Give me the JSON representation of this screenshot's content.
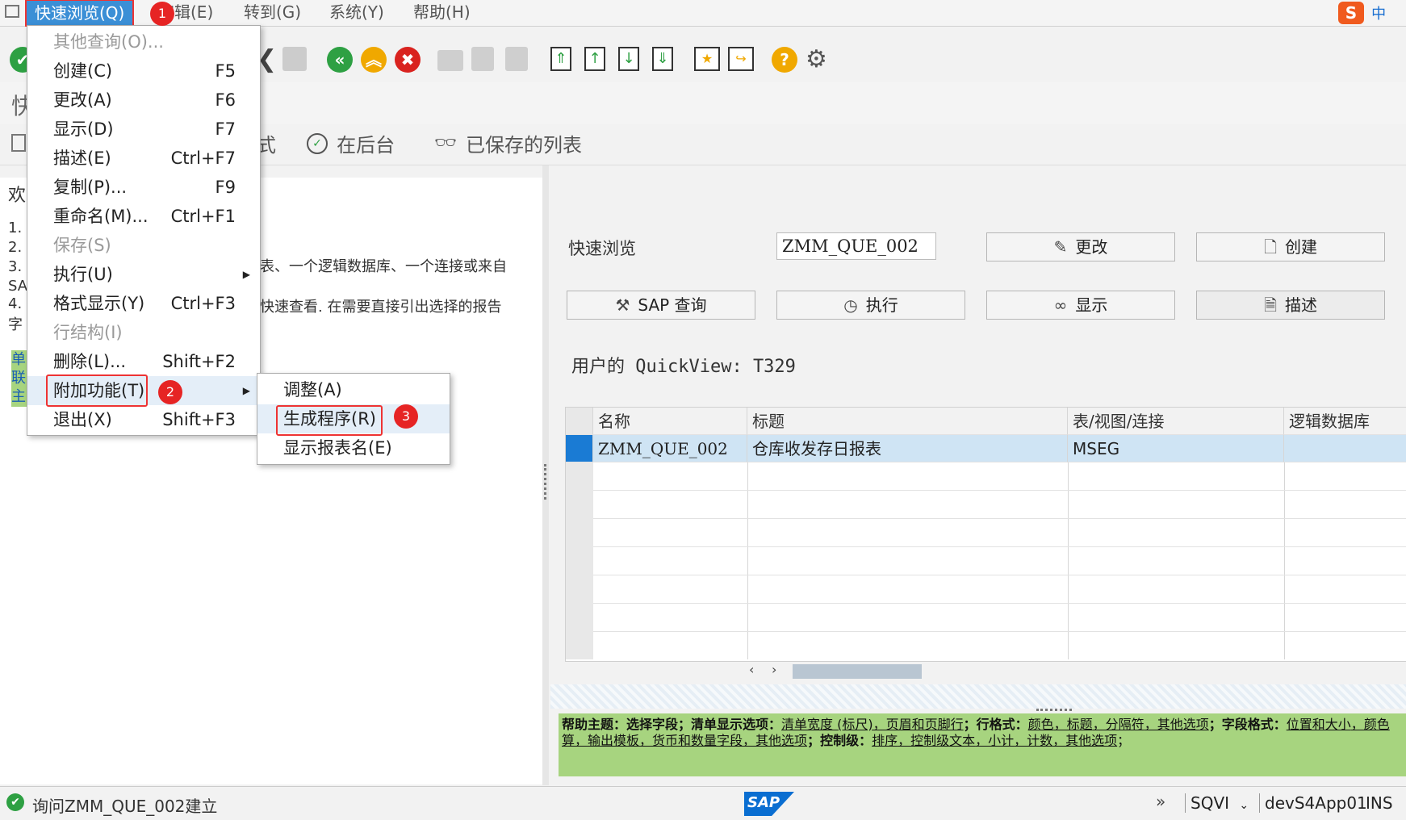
{
  "menubar": {
    "items": [
      "快速浏览(Q)",
      "编辑(E)",
      "转到(G)",
      "系统(Y)",
      "帮助(H)"
    ],
    "ime": "中"
  },
  "dropdown": {
    "items": [
      {
        "label": "其他查询(O)...",
        "shortcut": "",
        "disabled": true
      },
      {
        "label": "创建(C)",
        "shortcut": "F5",
        "disabled": false
      },
      {
        "label": "更改(A)",
        "shortcut": "F6",
        "disabled": false
      },
      {
        "label": "显示(D)",
        "shortcut": "F7",
        "disabled": false
      },
      {
        "label": "描述(E)",
        "shortcut": "Ctrl+F7",
        "disabled": false
      },
      {
        "label": "复制(P)...",
        "shortcut": "F9",
        "disabled": false
      },
      {
        "label": "重命名(M)...",
        "shortcut": "Ctrl+F1",
        "disabled": false
      },
      {
        "label": "保存(S)",
        "shortcut": "",
        "disabled": true
      },
      {
        "label": "执行(U)",
        "shortcut": "",
        "disabled": false
      },
      {
        "label": "格式显示(Y)",
        "shortcut": "Ctrl+F3",
        "disabled": false
      },
      {
        "label": "行结构(I)",
        "shortcut": "",
        "disabled": true
      },
      {
        "label": "删除(L)...",
        "shortcut": "Shift+F2",
        "disabled": false
      },
      {
        "label": "附加功能(T)",
        "shortcut": "",
        "disabled": false
      },
      {
        "label": "退出(X)",
        "shortcut": "Shift+F3",
        "disabled": false
      }
    ]
  },
  "submenu": {
    "items": [
      "调整(A)",
      "生成程序(R)",
      "显示报表名(E)"
    ]
  },
  "badges": [
    "1",
    "2",
    "3"
  ],
  "apptoolbar": {
    "items": [
      "式",
      "在后台",
      "已保存的列表"
    ]
  },
  "leftpane": {
    "heading_fragment": "欢",
    "list_markers": [
      "1.",
      "2.",
      "3.",
      "SA",
      "4.",
      "字"
    ],
    "text_line1": "表、一个逻辑数据库、一个连接或来自",
    "text_line2": "快速查看. 在需要直接引出选择的报告",
    "green_chars": [
      "单",
      "联",
      "主"
    ],
    "title_fragment": "快"
  },
  "rightpane": {
    "qv_label": "快速浏览",
    "qv_value": "ZMM_QUE_002",
    "buttons": {
      "change": "更改",
      "create": "创建",
      "sap_query": "SAP 查询",
      "execute": "执行",
      "display": "显示",
      "describe": "描述"
    },
    "user_label": "用户的 QuickView: T329"
  },
  "grid": {
    "headers": [
      "名称",
      "标题",
      "表/视图/连接",
      "逻辑数据库"
    ],
    "rows": [
      [
        "ZMM_QUE_002",
        "仓库收发存日报表",
        "MSEG",
        ""
      ]
    ]
  },
  "help": {
    "line1_parts": [
      "帮助主题：选择字段",
      "；清单显示选项：",
      "清单宽度 (标尺)",
      "，页眉和页脚行",
      "；行格式：",
      "颜色",
      "，标题",
      "，分隔符",
      "，其他选项",
      "；字段格式：",
      "位置和大小",
      "，颜色"
    ],
    "line2_parts": [
      "算",
      "，输出模板",
      "，货币和数量字段",
      "，其他选项",
      "；控制级：",
      "排序",
      "，控制级文本",
      "，小计",
      "，计数",
      "，其他选项",
      "；"
    ]
  },
  "statusbar": {
    "message": "询问ZMM_QUE_002建立",
    "system": "SQVI",
    "server": "devS4App01",
    "mode": "INS",
    "logo": "SAP"
  },
  "colors": {
    "accent": "#3b8fd6",
    "highlight": "#e33333",
    "help_bg": "#a7d47f",
    "selected_row": "#cfe4f4"
  }
}
